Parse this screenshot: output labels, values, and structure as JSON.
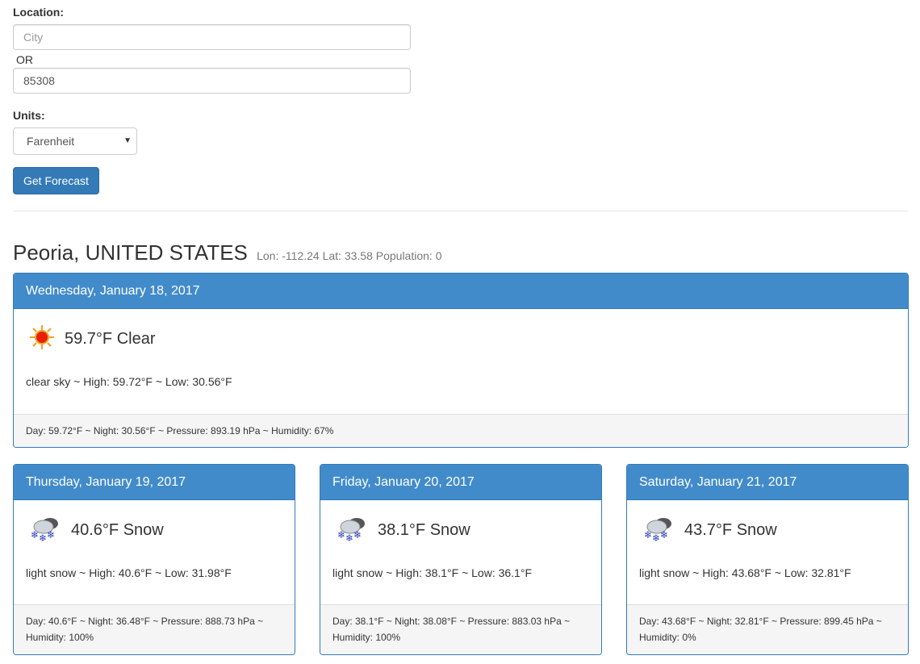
{
  "form": {
    "location_label": "Location:",
    "city_placeholder": "City",
    "city_value": "",
    "or_label": "OR",
    "zip_value": "85308",
    "units_label": "Units:",
    "units_selected": "Farenheit",
    "submit_label": "Get Forecast"
  },
  "location": {
    "name": "Peoria, UNITED STATES",
    "meta": "Lon: -112.24 Lat: 33.58 Population: 0"
  },
  "forecasts": [
    {
      "date": "Wednesday, January 18, 2017",
      "icon": "sun-icon",
      "summary": "59.7°F Clear",
      "detail": "clear sky ~  High: 59.72°F ~  Low: 30.56°F",
      "footer": "Day: 59.72°F ~  Night: 30.56°F ~  Pressure: 893.19 hPa ~  Humidity: 67%"
    },
    {
      "date": "Thursday, January 19, 2017",
      "icon": "snow-cloud-icon",
      "summary": "40.6°F Snow",
      "detail": "light snow ~  High: 40.6°F ~  Low: 31.98°F",
      "footer": "Day: 40.6°F ~  Night: 36.48°F ~  Pressure: 888.73 hPa ~  Humidity: 100%"
    },
    {
      "date": "Friday, January 20, 2017",
      "icon": "snow-cloud-icon",
      "summary": "38.1°F Snow",
      "detail": "light snow ~  High: 38.1°F ~  Low: 36.1°F",
      "footer": "Day: 38.1°F ~  Night: 38.08°F ~  Pressure: 883.03 hPa ~  Humidity: 100%"
    },
    {
      "date": "Saturday, January 21, 2017",
      "icon": "snow-cloud-icon",
      "summary": "43.7°F Snow",
      "detail": "light snow ~  High: 43.68°F ~  Low: 32.81°F",
      "footer": "Day: 43.68°F ~  Night: 32.81°F ~  Pressure: 899.45 hPa ~  Humidity: 0%"
    }
  ],
  "colors": {
    "panel_header": "#428bca",
    "panel_border": "#337ab7",
    "button": "#337ab7"
  }
}
